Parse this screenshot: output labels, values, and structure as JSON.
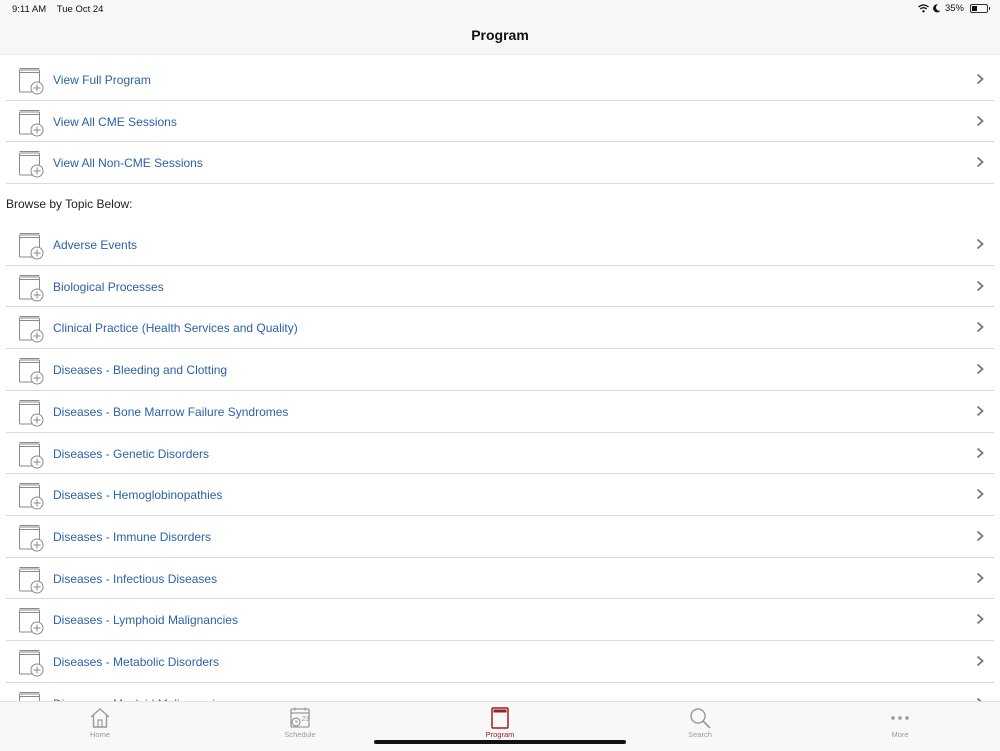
{
  "status": {
    "time": "9:11 AM",
    "date": "Tue Oct 24",
    "battery": "35%",
    "battery_level": 0.35
  },
  "header": {
    "title": "Program"
  },
  "top_items": [
    {
      "label": "View Full Program"
    },
    {
      "label": "View All CME Sessions"
    },
    {
      "label": "View All Non-CME Sessions"
    }
  ],
  "section_header": "Browse by Topic Below:",
  "topics": [
    {
      "label": "Adverse Events"
    },
    {
      "label": "Biological Processes"
    },
    {
      "label": "Clinical Practice (Health Services and Quality)"
    },
    {
      "label": "Diseases - Bleeding and Clotting"
    },
    {
      "label": "Diseases - Bone Marrow Failure Syndromes"
    },
    {
      "label": "Diseases - Genetic Disorders"
    },
    {
      "label": "Diseases - Hemoglobinopathies"
    },
    {
      "label": "Diseases - Immune Disorders"
    },
    {
      "label": "Diseases - Infectious Diseases"
    },
    {
      "label": "Diseases - Lymphoid Malignancies"
    },
    {
      "label": "Diseases - Metabolic Disorders"
    },
    {
      "label": "Diseases - Myeloid Malignancies"
    }
  ],
  "tabs": [
    {
      "label": "Home",
      "icon": "home-icon"
    },
    {
      "label": "Schedule",
      "icon": "calendar-icon"
    },
    {
      "label": "Program",
      "icon": "book-icon",
      "active": true
    },
    {
      "label": "Search",
      "icon": "search-icon"
    },
    {
      "label": "More",
      "icon": "more-icon"
    }
  ],
  "colors": {
    "link": "#2b62a8",
    "accent": "#a11d21",
    "inactive": "#9a9a9a"
  }
}
